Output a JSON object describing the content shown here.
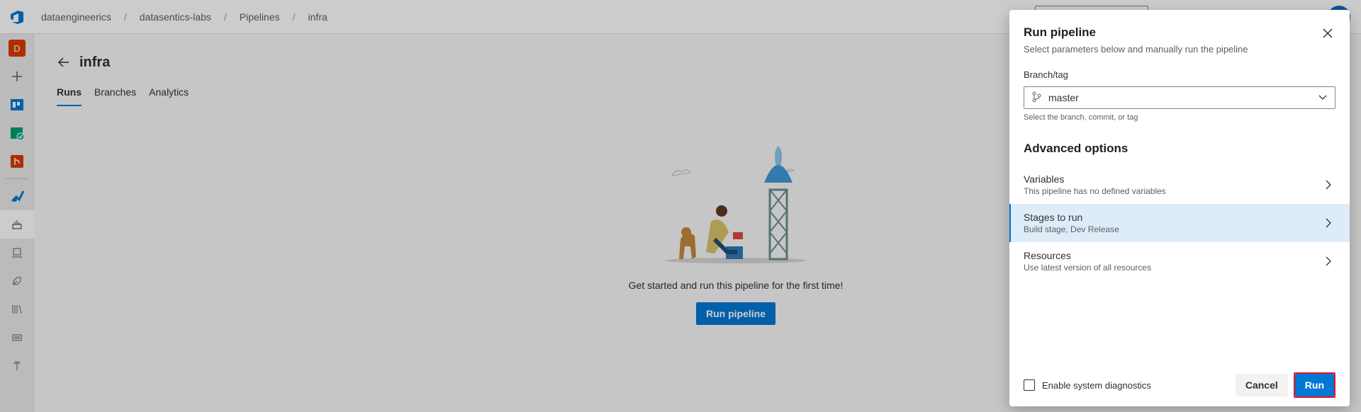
{
  "topbar": {
    "breadcrumbs": [
      "dataengineerics",
      "datasentics-labs",
      "Pipelines",
      "infra"
    ]
  },
  "rail": {
    "project_initial": "D",
    "icons": [
      "plus-icon",
      "boards-icon",
      "test-plans-icon",
      "repos-icon",
      "pipelines-icon",
      "pipelines-runs-icon",
      "environments-icon",
      "releases-icon",
      "library-icon",
      "task-groups-icon",
      "deployment-groups-icon"
    ]
  },
  "main": {
    "title": "infra",
    "tabs": [
      {
        "label": "Runs"
      },
      {
        "label": "Branches"
      },
      {
        "label": "Analytics"
      }
    ],
    "empty_message": "Get started and run this pipeline for the first time!",
    "run_pipeline_label": "Run pipeline"
  },
  "panel": {
    "title": "Run pipeline",
    "subtitle": "Select parameters below and manually run the pipeline",
    "branch_label": "Branch/tag",
    "branch_value": "master",
    "branch_helper": "Select the branch, commit, or tag",
    "section_title": "Advanced options",
    "options": [
      {
        "name": "Variables",
        "desc": "This pipeline has no defined variables"
      },
      {
        "name": "Stages to run",
        "desc": "Build stage, Dev Release"
      },
      {
        "name": "Resources",
        "desc": "Use latest version of all resources"
      }
    ],
    "diagnostics_label": "Enable system diagnostics",
    "cancel_label": "Cancel",
    "run_label": "Run"
  },
  "colors": {
    "accent": "#0078d4",
    "selected_bg": "#deecf9",
    "highlight_border": "#e81123"
  }
}
